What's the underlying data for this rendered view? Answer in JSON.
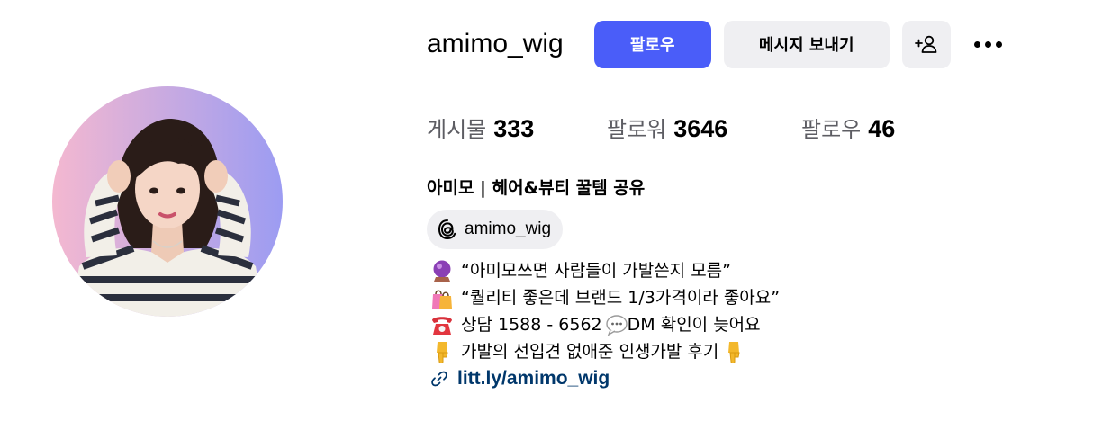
{
  "profile": {
    "username": "amimo_wig",
    "follow_label": "팔로우",
    "message_label": "메시지 보내기",
    "add_user_icon": "person-plus-icon",
    "more_icon": "more-dots-icon",
    "accent_color": "#4a5df9"
  },
  "stats": {
    "posts_label": "게시물",
    "posts_value": "333",
    "followers_label": "팔로워",
    "followers_value": "3646",
    "following_label": "팔로우",
    "following_value": "46"
  },
  "bio": {
    "name": "아미모 | 헤어&뷰티 꿀템 공유",
    "threads_handle": "amimo_wig",
    "lines": [
      {
        "emoji": "crystal-ball",
        "text": "“아미모쓰면 사람들이 가발쓴지 모름”"
      },
      {
        "emoji": "shopping-bags",
        "text": "“퀄리티 좋은데 브랜드 1/3가격이라 좋아요”"
      },
      {
        "emoji": "telephone",
        "text": "상담 1588 - 6562 ",
        "after_emoji": "speech-bubble",
        "after_text": "DM 확인이 늦어요"
      },
      {
        "emoji": "pointing-down",
        "text": "가발의 선입견 없애준 인생가발 후기 ",
        "after_emoji": "pointing-down"
      }
    ],
    "link": "litt.ly/amimo_wig",
    "link_color": "#00376b"
  }
}
